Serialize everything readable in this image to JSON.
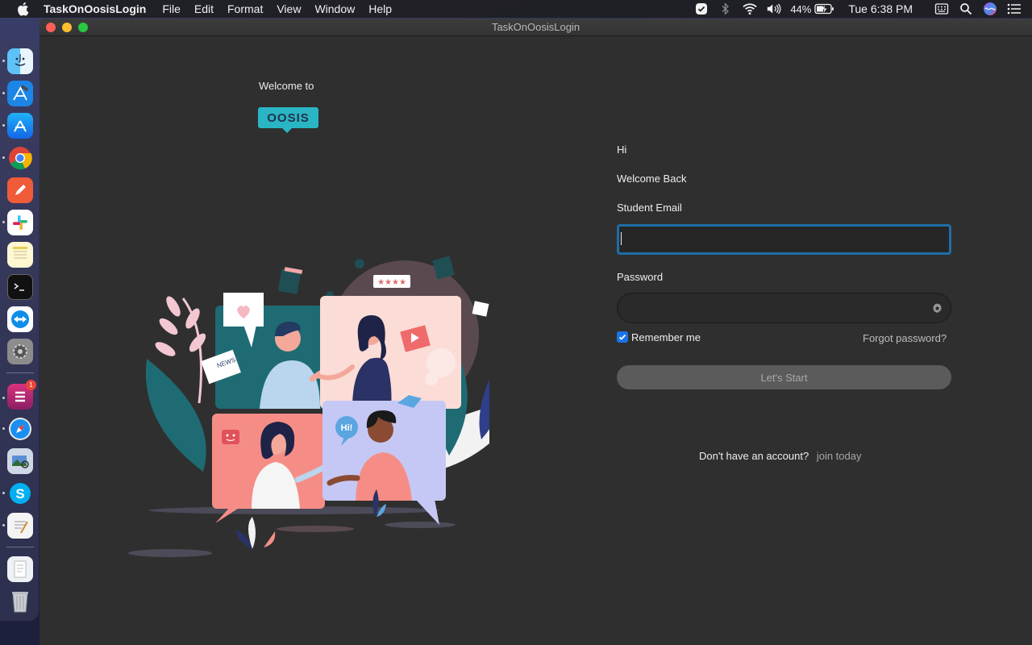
{
  "menubar": {
    "app_name": "TaskOnOosisLogin",
    "items": [
      "File",
      "Edit",
      "Format",
      "View",
      "Window",
      "Help"
    ],
    "battery": "44%",
    "clock": "Tue 6:38 PM"
  },
  "window": {
    "title": "TaskOnOosisLogin"
  },
  "branding": {
    "welcome_to": "Welcome to",
    "logo_text": "OOSIS",
    "logo_color": "#29b5c4"
  },
  "illustration": {
    "news_label": "NEWS",
    "hi_bubble": "Hi!"
  },
  "login": {
    "greeting": "Hi",
    "welcome_back": "Welcome Back",
    "email_label": "Student Email",
    "email_value": "",
    "password_label": "Password",
    "password_value": "",
    "remember_label": "Remember me",
    "remember_checked": true,
    "forgot_link": "Forgot password?",
    "submit_label": "Let's Start",
    "no_account_text": "Don't have an account?",
    "join_link": "join today"
  },
  "dock": {
    "apps": [
      "finder-icon",
      "xcode-icon",
      "app-store-icon",
      "chrome-icon",
      "pencil-app-icon",
      "slack-icon",
      "notes-icon",
      "terminal-icon",
      "teamviewer-icon",
      "system-preferences-icon",
      "task-app-icon",
      "safari-icon",
      "preview-icon",
      "skype-icon",
      "textedit-icon",
      "documents-icon",
      "trash-icon"
    ],
    "badge_count": "1"
  },
  "colors": {
    "accent": "#1e6ea8",
    "checkbox": "#1a73e8",
    "button_bg": "#5b5b5b",
    "window_bg": "#2f2f2f"
  }
}
